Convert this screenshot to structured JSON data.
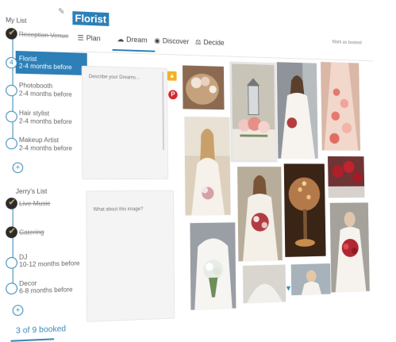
{
  "sidebar": {
    "my_list_heading": "My List",
    "items": [
      {
        "label": "Reception Venue",
        "sub": "",
        "state": "done"
      },
      {
        "label": "Florist",
        "sub": "2-4 months before",
        "state": "active"
      },
      {
        "label": "Photobooth",
        "sub": "2-4 months before",
        "state": "open"
      },
      {
        "label": "Hair stylist",
        "sub": "2-4 months before",
        "state": "open"
      },
      {
        "label": "Makeup Artist",
        "sub": "2-4 months before",
        "state": "open"
      }
    ],
    "add_symbol": "+",
    "partner_list_heading": "Jerry's List",
    "partner_items": [
      {
        "label": "Live Music",
        "sub": "",
        "state": "done"
      },
      {
        "label": "Catering",
        "sub": "",
        "state": "done"
      },
      {
        "label": "DJ",
        "sub": "10-12 months before",
        "state": "open"
      },
      {
        "label": "Decor",
        "sub": "6-8 months before",
        "state": "open"
      }
    ],
    "booked_text": "3 of 9 booked"
  },
  "header": {
    "title": "Florist",
    "tabs": [
      {
        "label": "Plan",
        "icon": "list-icon"
      },
      {
        "label": "Dream",
        "icon": "cloud-icon"
      },
      {
        "label": "Discover",
        "icon": "eye-icon"
      },
      {
        "label": "Decide",
        "icon": "scale-icon"
      }
    ],
    "active_tab": "Dream",
    "mark_booked": "Mark as booked"
  },
  "panels": {
    "dreams_placeholder": "Describe your Dreams...",
    "image_placeholder": "What about this image?"
  },
  "colors": {
    "accent": "#2d7fb8",
    "done_node": "#2b2b2b",
    "pinterest": "#d3272d",
    "ideas_badge": "#f5b026"
  }
}
